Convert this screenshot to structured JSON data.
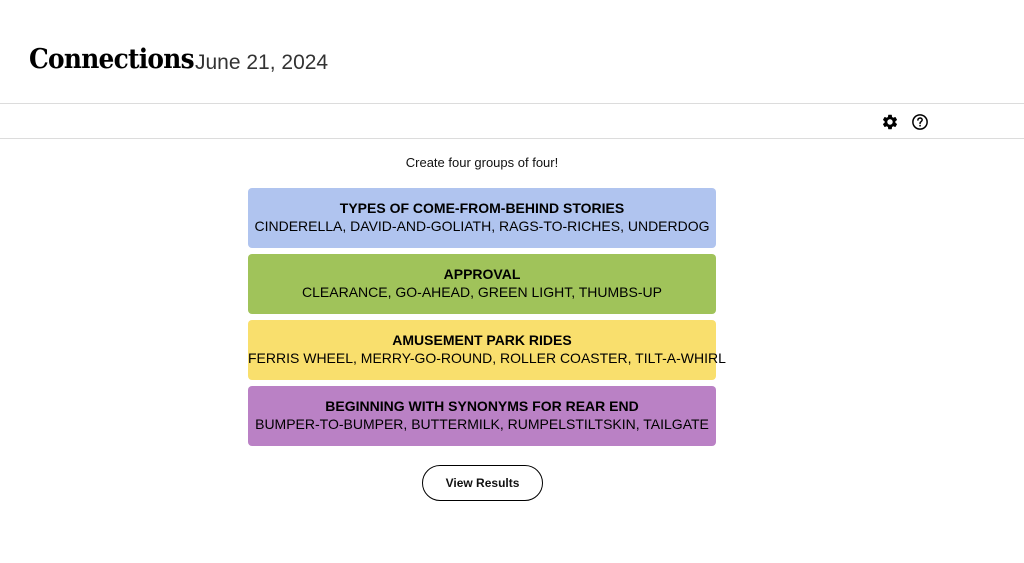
{
  "header": {
    "title": "Connections",
    "date": "June 21, 2024"
  },
  "toolbar": {
    "icons": [
      "gear-icon",
      "help-icon"
    ]
  },
  "main": {
    "instructions": "Create four groups of four!",
    "groups": [
      {
        "title": "TYPES OF COME-FROM-BEHIND STORIES",
        "members": "CINDERELLA, DAVID-AND-GOLIATH, RAGS-TO-RICHES, UNDERDOG",
        "color": "#b0c4ef"
      },
      {
        "title": "APPROVAL",
        "members": "CLEARANCE, GO-AHEAD, GREEN LIGHT, THUMBS-UP",
        "color": "#a0c35a"
      },
      {
        "title": "AMUSEMENT PARK RIDES",
        "members": "FERRIS WHEEL, MERRY-GO-ROUND, ROLLER COASTER, TILT-A-WHIRL",
        "color": "#f9df6d"
      },
      {
        "title": "BEGINNING WITH SYNONYMS FOR REAR END",
        "members": "BUMPER-TO-BUMPER, BUTTERMILK, RUMPELSTILTSKIN, TAILGATE",
        "color": "#ba81c5"
      }
    ],
    "results_button": "View Results"
  }
}
